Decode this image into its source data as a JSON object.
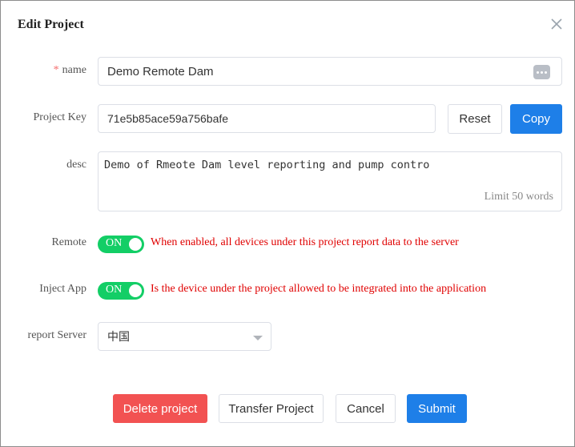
{
  "dialog": {
    "title": "Edit Project"
  },
  "form": {
    "name": {
      "required_mark": "*",
      "label": "name",
      "value": "Demo Remote Dam"
    },
    "project_key": {
      "label": "Project Key",
      "value": "71e5b85ace59a756bafe",
      "reset_label": "Reset",
      "copy_label": "Copy"
    },
    "desc": {
      "label": "desc",
      "value": "Demo of Rmeote Dam level reporting and pump contro",
      "limit_text": "Limit 50 words"
    },
    "remote": {
      "label": "Remote",
      "switch_text": "ON",
      "enabled": true,
      "hint": "When enabled, all devices under this project report data to the server"
    },
    "inject_app": {
      "label": "Inject App",
      "switch_text": "ON",
      "enabled": true,
      "hint": "Is the device under the project allowed to be integrated into the application"
    },
    "report_server": {
      "label": "report Server",
      "selected": "中国"
    }
  },
  "footer": {
    "delete_label": "Delete project",
    "transfer_label": "Transfer Project",
    "cancel_label": "Cancel",
    "submit_label": "Submit"
  },
  "colors": {
    "primary": "#1e7fe8",
    "danger": "#f25252",
    "switch_on": "#13ce66",
    "hint": "#e00000",
    "required": "#f56c6c"
  },
  "icons": {
    "close": "close-icon",
    "more": "more-icon",
    "dropdown": "chevron-down-icon"
  }
}
